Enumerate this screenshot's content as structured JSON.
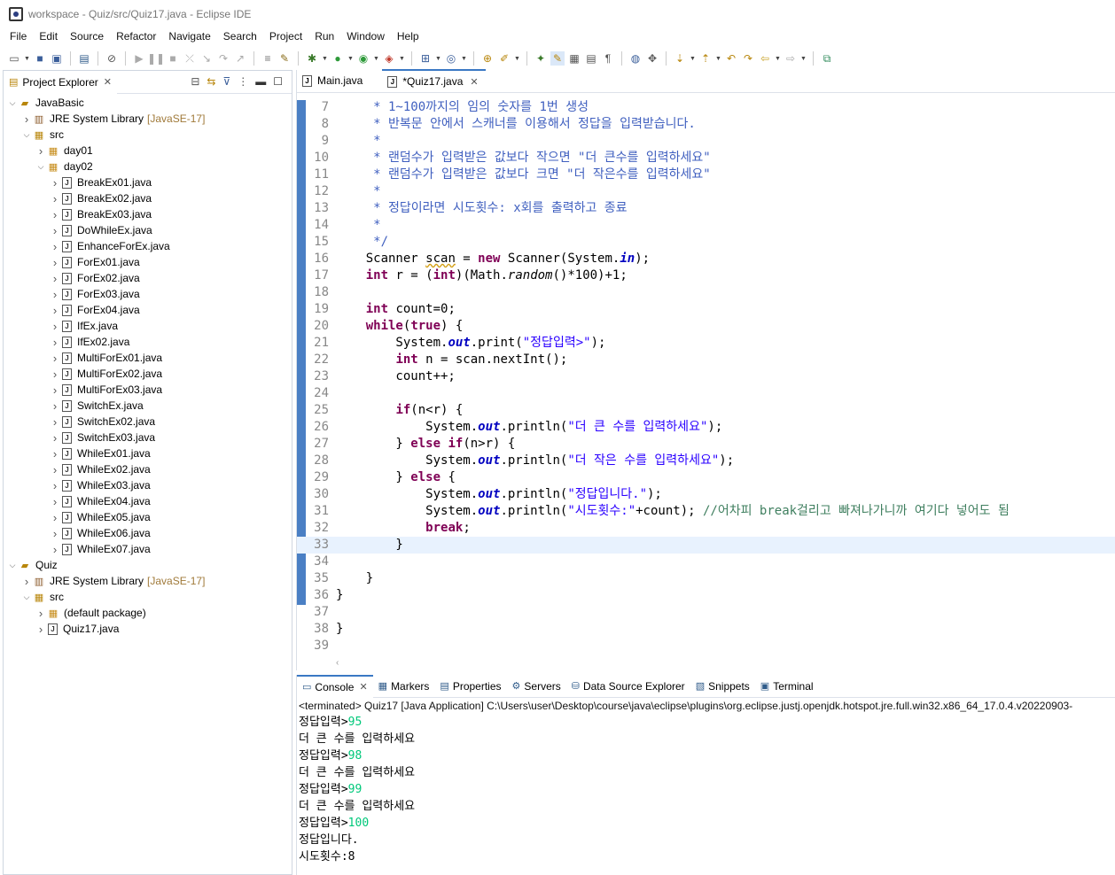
{
  "window": {
    "title": "workspace - Quiz/src/Quiz17.java - Eclipse IDE"
  },
  "menu": [
    "File",
    "Edit",
    "Source",
    "Refactor",
    "Navigate",
    "Search",
    "Project",
    "Run",
    "Window",
    "Help"
  ],
  "explorer": {
    "tab_label": "Project Explorer",
    "tree": [
      {
        "level": 0,
        "twisty": "open",
        "icon": "project-icon",
        "label": "JavaBasic"
      },
      {
        "level": 1,
        "twisty": "closed",
        "icon": "library-icon",
        "label": "JRE System Library",
        "suffix": "[JavaSE-17]"
      },
      {
        "level": 1,
        "twisty": "open",
        "icon": "source-folder-icon",
        "label": "src"
      },
      {
        "level": 2,
        "twisty": "closed",
        "icon": "package-icon",
        "label": "day01"
      },
      {
        "level": 2,
        "twisty": "open",
        "icon": "package-icon",
        "label": "day02"
      },
      {
        "level": 3,
        "twisty": "closed",
        "icon": "java-file-icon",
        "label": "BreakEx01.java"
      },
      {
        "level": 3,
        "twisty": "closed",
        "icon": "java-file-icon",
        "label": "BreakEx02.java"
      },
      {
        "level": 3,
        "twisty": "closed",
        "icon": "java-file-icon",
        "label": "BreakEx03.java"
      },
      {
        "level": 3,
        "twisty": "closed",
        "icon": "java-file-icon",
        "label": "DoWhileEx.java"
      },
      {
        "level": 3,
        "twisty": "closed",
        "icon": "java-file-icon",
        "label": "EnhanceForEx.java"
      },
      {
        "level": 3,
        "twisty": "closed",
        "icon": "java-file-icon",
        "label": "ForEx01.java"
      },
      {
        "level": 3,
        "twisty": "closed",
        "icon": "java-file-icon",
        "label": "ForEx02.java"
      },
      {
        "level": 3,
        "twisty": "closed",
        "icon": "java-file-icon",
        "label": "ForEx03.java"
      },
      {
        "level": 3,
        "twisty": "closed",
        "icon": "java-file-icon",
        "label": "ForEx04.java"
      },
      {
        "level": 3,
        "twisty": "closed",
        "icon": "java-file-icon",
        "label": "IfEx.java"
      },
      {
        "level": 3,
        "twisty": "closed",
        "icon": "java-file-icon",
        "label": "IfEx02.java"
      },
      {
        "level": 3,
        "twisty": "closed",
        "icon": "java-file-icon",
        "label": "MultiForEx01.java"
      },
      {
        "level": 3,
        "twisty": "closed",
        "icon": "java-file-icon",
        "label": "MultiForEx02.java"
      },
      {
        "level": 3,
        "twisty": "closed",
        "icon": "java-file-icon",
        "label": "MultiForEx03.java"
      },
      {
        "level": 3,
        "twisty": "closed",
        "icon": "java-file-icon",
        "label": "SwitchEx.java"
      },
      {
        "level": 3,
        "twisty": "closed",
        "icon": "java-file-icon",
        "label": "SwitchEx02.java"
      },
      {
        "level": 3,
        "twisty": "closed",
        "icon": "java-file-icon",
        "label": "SwitchEx03.java"
      },
      {
        "level": 3,
        "twisty": "closed",
        "icon": "java-file-icon",
        "label": "WhileEx01.java"
      },
      {
        "level": 3,
        "twisty": "closed",
        "icon": "java-file-icon",
        "label": "WhileEx02.java"
      },
      {
        "level": 3,
        "twisty": "closed",
        "icon": "java-file-icon",
        "label": "WhileEx03.java"
      },
      {
        "level": 3,
        "twisty": "closed",
        "icon": "java-file-icon",
        "label": "WhileEx04.java"
      },
      {
        "level": 3,
        "twisty": "closed",
        "icon": "java-file-icon",
        "label": "WhileEx05.java"
      },
      {
        "level": 3,
        "twisty": "closed",
        "icon": "java-file-icon",
        "label": "WhileEx06.java"
      },
      {
        "level": 3,
        "twisty": "closed",
        "icon": "java-file-icon",
        "label": "WhileEx07.java"
      },
      {
        "level": 0,
        "twisty": "open",
        "icon": "project-icon",
        "label": "Quiz"
      },
      {
        "level": 1,
        "twisty": "closed",
        "icon": "library-icon",
        "label": "JRE System Library",
        "suffix": "[JavaSE-17]"
      },
      {
        "level": 1,
        "twisty": "open",
        "icon": "source-folder-icon",
        "label": "src"
      },
      {
        "level": 2,
        "twisty": "closed",
        "icon": "package-icon",
        "label": "(default package)"
      },
      {
        "level": 2,
        "twisty": "closed",
        "icon": "java-file-icon",
        "label": "Quiz17.java"
      }
    ]
  },
  "editor": {
    "tabs": [
      {
        "label": "Main.java",
        "active": false
      },
      {
        "label": "*Quiz17.java",
        "active": true
      }
    ],
    "current_line": "33",
    "lines": [
      {
        "n": "7",
        "s": [
          [
            "cm",
            "     * 1~100까지의 임의 숫자를 1번 생성"
          ]
        ]
      },
      {
        "n": "8",
        "s": [
          [
            "cm",
            "     * 반복문 안에서 스캐너를 이용해서 정답을 입력받습니다."
          ]
        ]
      },
      {
        "n": "9",
        "s": [
          [
            "cm",
            "     *"
          ]
        ]
      },
      {
        "n": "10",
        "s": [
          [
            "cm",
            "     * 랜덤수가 입력받은 값보다 작으면 \"더 큰수를 입력하세요\""
          ]
        ]
      },
      {
        "n": "11",
        "s": [
          [
            "cm",
            "     * 랜덤수가 입력받은 값보다 크면 \"더 작은수를 입력하세요\""
          ]
        ]
      },
      {
        "n": "12",
        "s": [
          [
            "cm",
            "     *"
          ]
        ]
      },
      {
        "n": "13",
        "s": [
          [
            "cm",
            "     * 정답이라면 시도횟수: x회를 출력하고 종료"
          ]
        ]
      },
      {
        "n": "14",
        "s": [
          [
            "cm",
            "     *"
          ]
        ]
      },
      {
        "n": "15",
        "s": [
          [
            "cm",
            "     */"
          ]
        ]
      },
      {
        "n": "16",
        "s": [
          [
            "",
            "    Scanner "
          ],
          [
            "warn",
            "scan"
          ],
          [
            "",
            " = "
          ],
          [
            "kw",
            "new"
          ],
          [
            "",
            " Scanner(System."
          ],
          [
            "fld",
            "in"
          ],
          [
            "",
            ");"
          ]
        ]
      },
      {
        "n": "17",
        "s": [
          [
            "",
            "    "
          ],
          [
            "kw",
            "int"
          ],
          [
            "",
            " r = ("
          ],
          [
            "kw",
            "int"
          ],
          [
            "",
            ")(Math."
          ],
          [
            "it",
            "random"
          ],
          [
            "",
            "()*100)+1;"
          ]
        ]
      },
      {
        "n": "18",
        "s": [
          [
            "",
            ""
          ]
        ]
      },
      {
        "n": "19",
        "s": [
          [
            "",
            "    "
          ],
          [
            "kw",
            "int"
          ],
          [
            "",
            " count=0;"
          ]
        ]
      },
      {
        "n": "20",
        "s": [
          [
            "",
            "    "
          ],
          [
            "kw",
            "while"
          ],
          [
            "",
            "("
          ],
          [
            "kw",
            "true"
          ],
          [
            "",
            ") {"
          ]
        ]
      },
      {
        "n": "21",
        "s": [
          [
            "",
            "        System."
          ],
          [
            "fld",
            "out"
          ],
          [
            "",
            ".print("
          ],
          [
            "str",
            "\"정답입력>\""
          ],
          [
            "",
            ");"
          ]
        ]
      },
      {
        "n": "22",
        "s": [
          [
            "",
            "        "
          ],
          [
            "kw",
            "int"
          ],
          [
            "",
            " n = scan.nextInt();"
          ]
        ]
      },
      {
        "n": "23",
        "s": [
          [
            "",
            "        count++;"
          ]
        ]
      },
      {
        "n": "24",
        "s": [
          [
            "",
            ""
          ]
        ]
      },
      {
        "n": "25",
        "s": [
          [
            "",
            "        "
          ],
          [
            "kw",
            "if"
          ],
          [
            "",
            "(n<r) {"
          ]
        ]
      },
      {
        "n": "26",
        "s": [
          [
            "",
            "            System."
          ],
          [
            "fld",
            "out"
          ],
          [
            "",
            ".println("
          ],
          [
            "str",
            "\"더 큰 수를 입력하세요\""
          ],
          [
            "",
            ");"
          ]
        ]
      },
      {
        "n": "27",
        "s": [
          [
            "",
            "        } "
          ],
          [
            "kw",
            "else if"
          ],
          [
            "",
            "(n>r) {"
          ]
        ]
      },
      {
        "n": "28",
        "s": [
          [
            "",
            "            System."
          ],
          [
            "fld",
            "out"
          ],
          [
            "",
            ".println("
          ],
          [
            "str",
            "\"더 작은 수를 입력하세요\""
          ],
          [
            "",
            ");"
          ]
        ]
      },
      {
        "n": "29",
        "s": [
          [
            "",
            "        } "
          ],
          [
            "kw",
            "else"
          ],
          [
            "",
            " {"
          ]
        ]
      },
      {
        "n": "30",
        "s": [
          [
            "",
            "            System."
          ],
          [
            "fld",
            "out"
          ],
          [
            "",
            ".println("
          ],
          [
            "str",
            "\"정답입니다.\""
          ],
          [
            "",
            ");"
          ]
        ]
      },
      {
        "n": "31",
        "s": [
          [
            "",
            "            System."
          ],
          [
            "fld",
            "out"
          ],
          [
            "",
            ".println("
          ],
          [
            "str",
            "\"시도횟수:\""
          ],
          [
            "",
            "+count); "
          ],
          [
            "lc",
            "//어차피 break걸리고 빠져나가니까 여기다 넣어도 됨"
          ]
        ]
      },
      {
        "n": "32",
        "s": [
          [
            "",
            "            "
          ],
          [
            "kw",
            "break"
          ],
          [
            "",
            ";"
          ]
        ]
      },
      {
        "n": "33",
        "s": [
          [
            "",
            "        }"
          ]
        ]
      },
      {
        "n": "34",
        "s": [
          [
            "",
            ""
          ]
        ]
      },
      {
        "n": "35",
        "s": [
          [
            "",
            "    }"
          ]
        ]
      },
      {
        "n": "36",
        "s": [
          [
            "",
            "}"
          ]
        ]
      },
      {
        "n": "37",
        "s": [
          [
            "",
            ""
          ]
        ]
      },
      {
        "n": "38",
        "s": [
          [
            "",
            "}"
          ]
        ]
      },
      {
        "n": "39",
        "s": [
          [
            "",
            ""
          ]
        ]
      }
    ]
  },
  "console": {
    "tabs": [
      {
        "icon": "console-icon",
        "label": "Console",
        "active": true
      },
      {
        "icon": "markers-icon",
        "label": "Markers",
        "active": false
      },
      {
        "icon": "properties-icon",
        "label": "Properties",
        "active": false
      },
      {
        "icon": "servers-icon",
        "label": "Servers",
        "active": false
      },
      {
        "icon": "data-source-icon",
        "label": "Data Source Explorer",
        "active": false
      },
      {
        "icon": "snippets-icon",
        "label": "Snippets",
        "active": false
      },
      {
        "icon": "terminal-icon",
        "label": "Terminal",
        "active": false
      }
    ],
    "status": "<terminated> Quiz17 [Java Application] C:\\Users\\user\\Desktop\\course\\java\\eclipse\\plugins\\org.eclipse.justj.openjdk.hotspot.jre.full.win32.x86_64_17.0.4.v20220903-",
    "output": [
      {
        "text": "정답입력>",
        "input": "95"
      },
      {
        "text": "더 큰 수를 입력하세요",
        "input": ""
      },
      {
        "text": "정답입력>",
        "input": "98"
      },
      {
        "text": "더 큰 수를 입력하세요",
        "input": ""
      },
      {
        "text": "정답입력>",
        "input": "99"
      },
      {
        "text": "더 큰 수를 입력하세요",
        "input": ""
      },
      {
        "text": "정답입력>",
        "input": "100"
      },
      {
        "text": "정답입니다.",
        "input": ""
      },
      {
        "text": "시도횟수:8",
        "input": ""
      }
    ]
  }
}
